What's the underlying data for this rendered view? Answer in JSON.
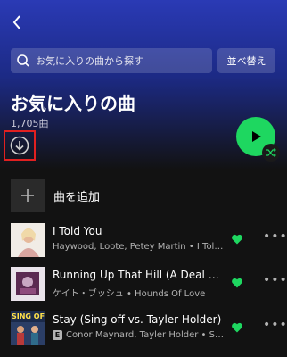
{
  "header": {
    "search_placeholder": "お気に入りの曲から探す",
    "sort_label": "並べ替え",
    "title": "お気に入りの曲",
    "count": "1,705曲"
  },
  "add_song": {
    "label": "曲を追加"
  },
  "tracks": [
    {
      "title": "I Told You",
      "meta": "Haywood, Loote, Petey Martin • I Told...",
      "explicit": false
    },
    {
      "title": "Running Up That Hill (A Deal Wi...",
      "meta": "ケイト・ブッシュ • Hounds Of Love",
      "explicit": false
    },
    {
      "title": "Stay (Sing off vs. Tayler Holder)",
      "meta": "Conor Maynard, Tayler Holder • Stay...",
      "explicit": true,
      "explicit_label": "E",
      "cover_text": "SING OFF"
    }
  ],
  "colors": {
    "accent": "#1ed760",
    "header_gradient_top": "#2a3ab5",
    "background": "#121212",
    "highlight_box": "#e02020"
  }
}
